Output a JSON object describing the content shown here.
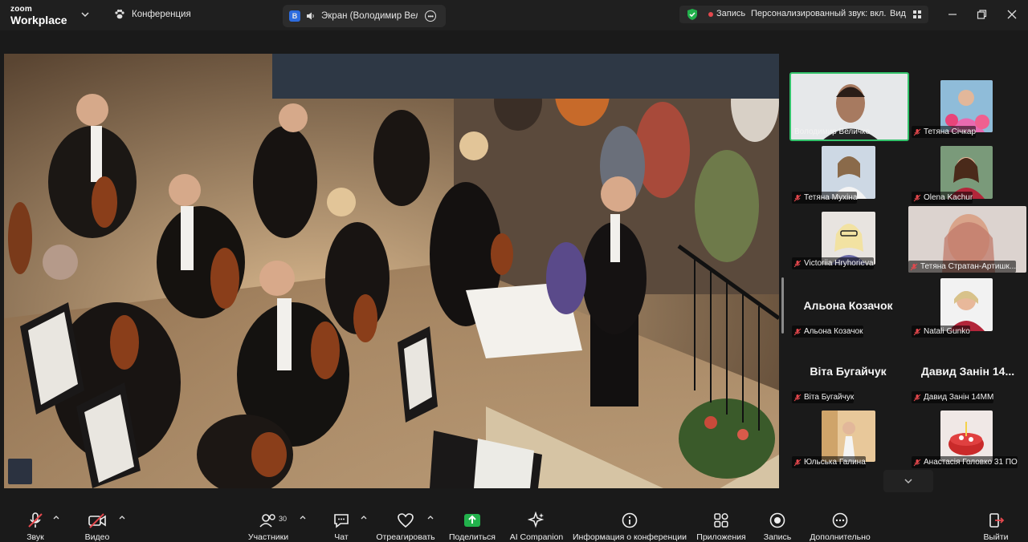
{
  "app": {
    "logo_small": "zoom",
    "logo_large": "Workplace",
    "conference_label": "Конференция"
  },
  "share_tab": {
    "badge": "В",
    "title": "Экран (Володимир Величко"
  },
  "status": {
    "record_label": "Запись",
    "audio_label": "Персонализированный звук: вкл.",
    "view_label": "Вид"
  },
  "gallery": {
    "participants": [
      {
        "name": "Володимир Величко",
        "muted": false,
        "active": true
      },
      {
        "name": "Тетяна Січкар",
        "muted": true
      },
      {
        "name": "Тетяна Мухіна",
        "muted": true
      },
      {
        "name": "Olena Kachur",
        "muted": true
      },
      {
        "name": "Victoriia Hryhorieva",
        "muted": true
      },
      {
        "name": "Тетяна Стратан-Артишк...",
        "muted": true
      },
      {
        "name": "Альона Козачок",
        "muted": true,
        "big_name": "Альона Козачок"
      },
      {
        "name": "Natali Gunko",
        "muted": true
      },
      {
        "name": "Віта Бугайчук",
        "muted": true,
        "big_name": "Віта Бугайчук"
      },
      {
        "name": "Давид Занін 14ММ",
        "muted": true,
        "big_name": "Давид Занін 14..."
      },
      {
        "name": "Юльська Галина",
        "muted": true
      },
      {
        "name": "Анастасія Головко 31 ПО",
        "muted": true
      }
    ]
  },
  "toolbar": {
    "audio": "Звук",
    "video": "Видео",
    "participants": "Участники",
    "participants_count": "30",
    "chat": "Чат",
    "react": "Отреагировать",
    "share": "Поделиться",
    "companion": "AI Companion",
    "info": "Информация о конференции",
    "apps": "Приложения",
    "record": "Запись",
    "more": "Дополнительно",
    "leave": "Выйти"
  },
  "colors": {
    "background": "#1a1a1a",
    "active_speaker": "#33c26b",
    "share_green": "#22b14c",
    "mute_red": "#e5484d",
    "leave_red": "#e5484d"
  }
}
